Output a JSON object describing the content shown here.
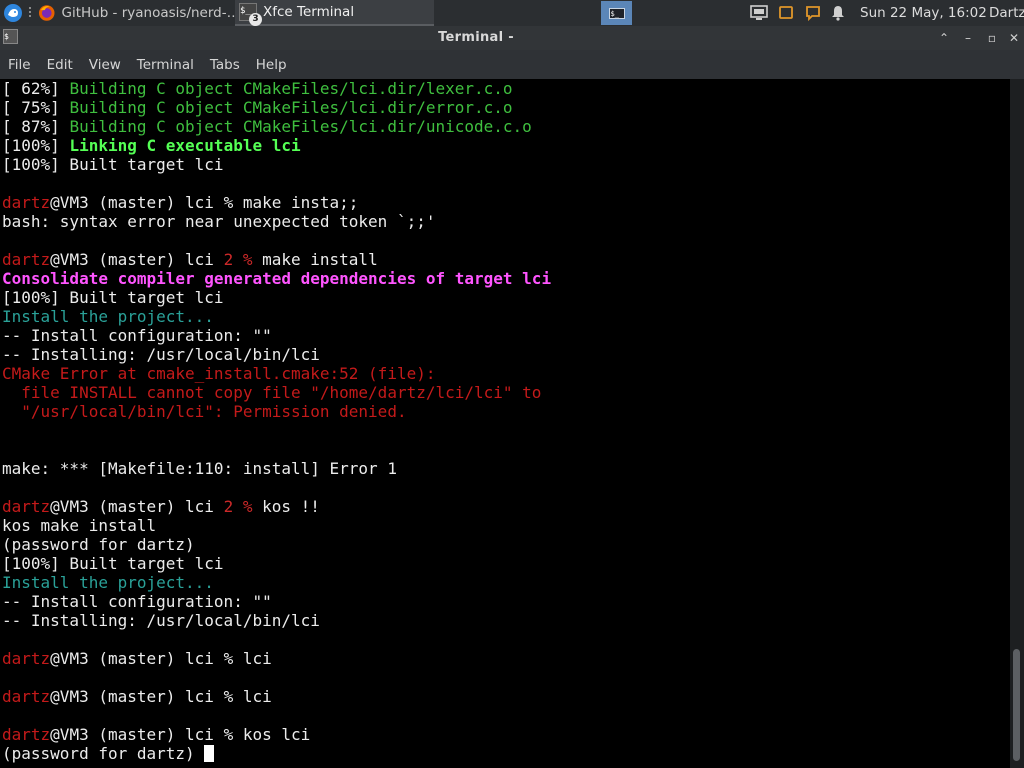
{
  "panel": {
    "tasks": [
      {
        "label": "GitHub - ryanoasis/nerd-…",
        "icon": "firefox-icon"
      },
      {
        "label": "Xfce Terminal",
        "icon": "terminal-icon",
        "badge": "3"
      }
    ],
    "workspace_icon": "$_",
    "clock": "Sun 22 May, 16:02",
    "user": "Dartz"
  },
  "window": {
    "title": "Terminal -",
    "icon_glyph": "$",
    "menu": [
      "File",
      "Edit",
      "View",
      "Terminal",
      "Tabs",
      "Help"
    ]
  },
  "terminal": {
    "lines": [
      [
        {
          "t": "[ 62%] "
        },
        {
          "t": "Building C object CMakeFiles/lci.dir/lexer.c.o",
          "c": "g"
        }
      ],
      [
        {
          "t": "[ 75%] "
        },
        {
          "t": "Building C object CMakeFiles/lci.dir/error.c.o",
          "c": "g"
        }
      ],
      [
        {
          "t": "[ 87%] "
        },
        {
          "t": "Building C object CMakeFiles/lci.dir/unicode.c.o",
          "c": "g"
        }
      ],
      [
        {
          "t": "[100%] "
        },
        {
          "t": "Linking C executable lci",
          "c": "gb"
        }
      ],
      [
        {
          "t": "[100%] Built target lci"
        }
      ],
      [],
      [
        {
          "t": "dartz",
          "c": "r"
        },
        {
          "t": "@VM3 (master) lci % make insta;;"
        }
      ],
      [
        {
          "t": "bash: syntax error near unexpected token `;;'"
        }
      ],
      [],
      [
        {
          "t": "dartz",
          "c": "r"
        },
        {
          "t": "@VM3 (master) lci "
        },
        {
          "t": "2 %",
          "c": "u"
        },
        {
          "t": " make install"
        }
      ],
      [
        {
          "t": "Consolidate compiler generated dependencies of target lci",
          "c": "m"
        }
      ],
      [
        {
          "t": "[100%] Built target lci"
        }
      ],
      [
        {
          "t": "Install the project...",
          "c": "c"
        }
      ],
      [
        {
          "t": "-- Install configuration: \"\""
        }
      ],
      [
        {
          "t": "-- Installing: /usr/local/bin/lci"
        }
      ],
      [
        {
          "t": "CMake Error at cmake_install.cmake:52 (file):",
          "c": "r"
        }
      ],
      [
        {
          "t": "  file INSTALL cannot copy file \"/home/dartz/lci/lci\" to",
          "c": "r"
        }
      ],
      [
        {
          "t": "  \"/usr/local/bin/lci\": Permission denied.",
          "c": "r"
        }
      ],
      [],
      [],
      [
        {
          "t": "make: *** [Makefile:110: install] Error 1"
        }
      ],
      [],
      [
        {
          "t": "dartz",
          "c": "r"
        },
        {
          "t": "@VM3 (master) lci "
        },
        {
          "t": "2 %",
          "c": "u"
        },
        {
          "t": " kos !!"
        }
      ],
      [
        {
          "t": "kos make install"
        }
      ],
      [
        {
          "t": "(password for dartz)"
        }
      ],
      [
        {
          "t": "[100%] Built target lci"
        }
      ],
      [
        {
          "t": "Install the project...",
          "c": "c"
        }
      ],
      [
        {
          "t": "-- Install configuration: \"\""
        }
      ],
      [
        {
          "t": "-- Installing: /usr/local/bin/lci"
        }
      ],
      [],
      [
        {
          "t": "dartz",
          "c": "r"
        },
        {
          "t": "@VM3 (master) lci % lci"
        }
      ],
      [],
      [
        {
          "t": "dartz",
          "c": "r"
        },
        {
          "t": "@VM3 (master) lci % lci"
        }
      ],
      [],
      [
        {
          "t": "dartz",
          "c": "r"
        },
        {
          "t": "@VM3 (master) lci % kos lci"
        }
      ],
      [
        {
          "t": "(password for dartz) "
        }
      ]
    ]
  }
}
